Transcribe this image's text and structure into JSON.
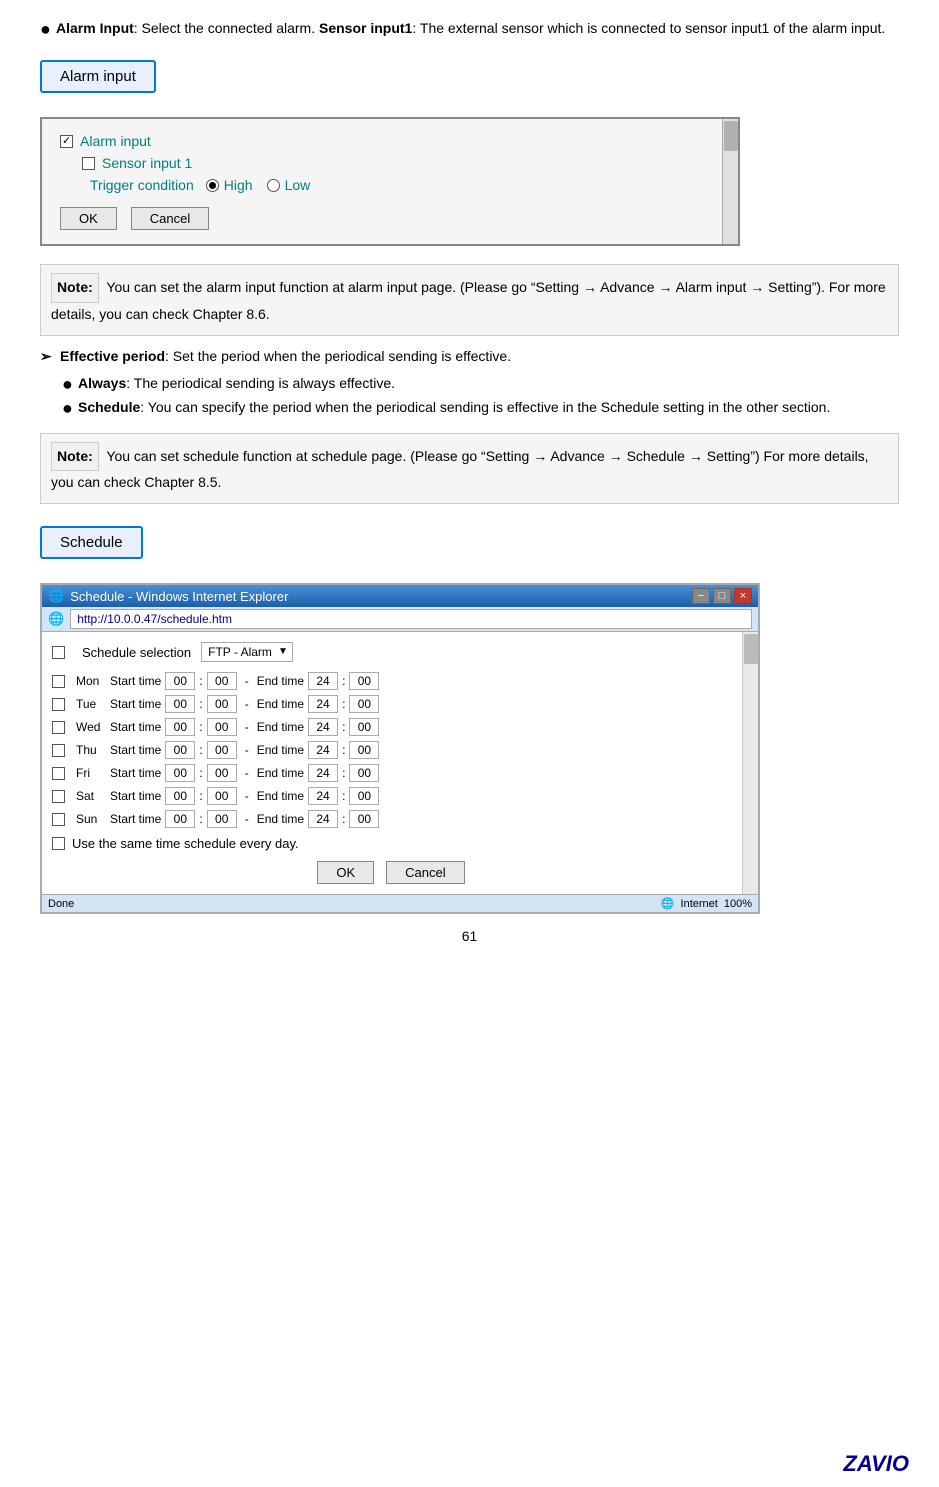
{
  "alarm_button": "Alarm input",
  "schedule_button": "Schedule",
  "intro_text": {
    "bullet1_label": "Alarm Input",
    "bullet1_colon": ": Select the connected alarm. ",
    "bullet1_bold": "Sensor input1",
    "bullet1_rest": ": The external sensor which is connected to sensor input1 of the alarm input."
  },
  "alarm_dialog": {
    "checkbox1_label": "Alarm input",
    "checkbox2_label": "Sensor input 1",
    "trigger_label": "Trigger condition",
    "high_label": "High",
    "low_label": "Low",
    "ok_label": "OK",
    "cancel_label": "Cancel"
  },
  "note1": {
    "label": "Note:",
    "text": "You can set the alarm input function at alarm input page. (Please go “Setting → Advance → Alarm input → Setting”). For more details, you can check Chapter 8.6."
  },
  "effective_period": {
    "label": "Effective period",
    "colon": ": Set the period when the periodical sending is effective.",
    "always_label": "Always",
    "always_text": ": The periodical sending is always effective.",
    "schedule_label": "Schedule",
    "schedule_text": ": You can specify the period when the periodical sending is effective in the Schedule setting in the other section."
  },
  "note2": {
    "label": "Note:",
    "text": "You can set schedule function at schedule page. (Please go “Setting → Advance → Schedule → Setting”) For more details, you can check Chapter 8.5."
  },
  "ie_window": {
    "title": "Schedule - Windows Internet Explorer",
    "address": "http://10.0.0.47/schedule.htm",
    "schedule_label": "Schedule selection",
    "dropdown_value": "FTP - Alarm",
    "days": [
      {
        "name": "Mon",
        "start_h": "00",
        "start_m": "00",
        "end_h": "24",
        "end_m": "00"
      },
      {
        "name": "Tue",
        "start_h": "00",
        "start_m": "00",
        "end_h": "24",
        "end_m": "00"
      },
      {
        "name": "Wed",
        "start_h": "00",
        "start_m": "00",
        "end_h": "24",
        "end_m": "00"
      },
      {
        "name": "Thu",
        "start_h": "00",
        "start_m": "00",
        "end_h": "24",
        "end_m": "00"
      },
      {
        "name": "Fri",
        "start_h": "00",
        "start_m": "00",
        "end_h": "24",
        "end_m": "00"
      },
      {
        "name": "Sat",
        "start_h": "00",
        "start_m": "00",
        "end_h": "24",
        "end_m": "00"
      },
      {
        "name": "Sun",
        "start_h": "00",
        "start_m": "00",
        "end_h": "24",
        "end_m": "00"
      }
    ],
    "start_time_label": "Start time",
    "end_time_label": "End time",
    "same_time_label": "Use the same time schedule every day.",
    "ok_label": "OK",
    "cancel_label": "Cancel",
    "status_left": "Done",
    "status_right": "Internet",
    "zoom_label": "100%",
    "min_btn": "−",
    "max_btn": "□",
    "close_btn": "×"
  },
  "page_number": "61"
}
